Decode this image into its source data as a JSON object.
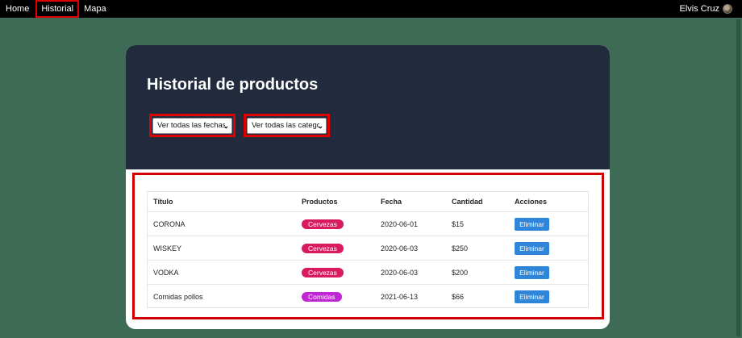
{
  "nav": {
    "items": [
      {
        "label": "Home"
      },
      {
        "label": "Historial"
      },
      {
        "label": "Mapa"
      }
    ],
    "user_name": "Elvis Cruz"
  },
  "page": {
    "title": "Historial de productos",
    "filters": {
      "dates_value": "Ver todas las fechas",
      "categories_value": "Ver todas las categorías"
    }
  },
  "table": {
    "headers": [
      "Título",
      "Productos",
      "Fecha",
      "Cantidad",
      "Acciones"
    ],
    "rows": [
      {
        "title": "CORONA",
        "category": "Cervezas",
        "date": "2020-06-01",
        "amount": "$15",
        "action": "Eliminar"
      },
      {
        "title": "WISKEY",
        "category": "Cervezas",
        "date": "2020-06-03",
        "amount": "$250",
        "action": "Eliminar"
      },
      {
        "title": "VODKA",
        "category": "Cervezas",
        "date": "2020-06-03",
        "amount": "$200",
        "action": "Eliminar"
      },
      {
        "title": "Comidas pollos",
        "category": "Comidas",
        "date": "2021-06-13",
        "amount": "$66",
        "action": "Eliminar"
      }
    ]
  },
  "colors": {
    "background": "#3e6b56",
    "header": "#222b3d",
    "highlight": "#e00000",
    "badge_cervezas": "#d81b5f",
    "badge_comidas": "#c026d3",
    "button": "#2f86d8"
  },
  "icons": {
    "avatar": "avatar",
    "select_arrow": "chevron-down-icon"
  }
}
